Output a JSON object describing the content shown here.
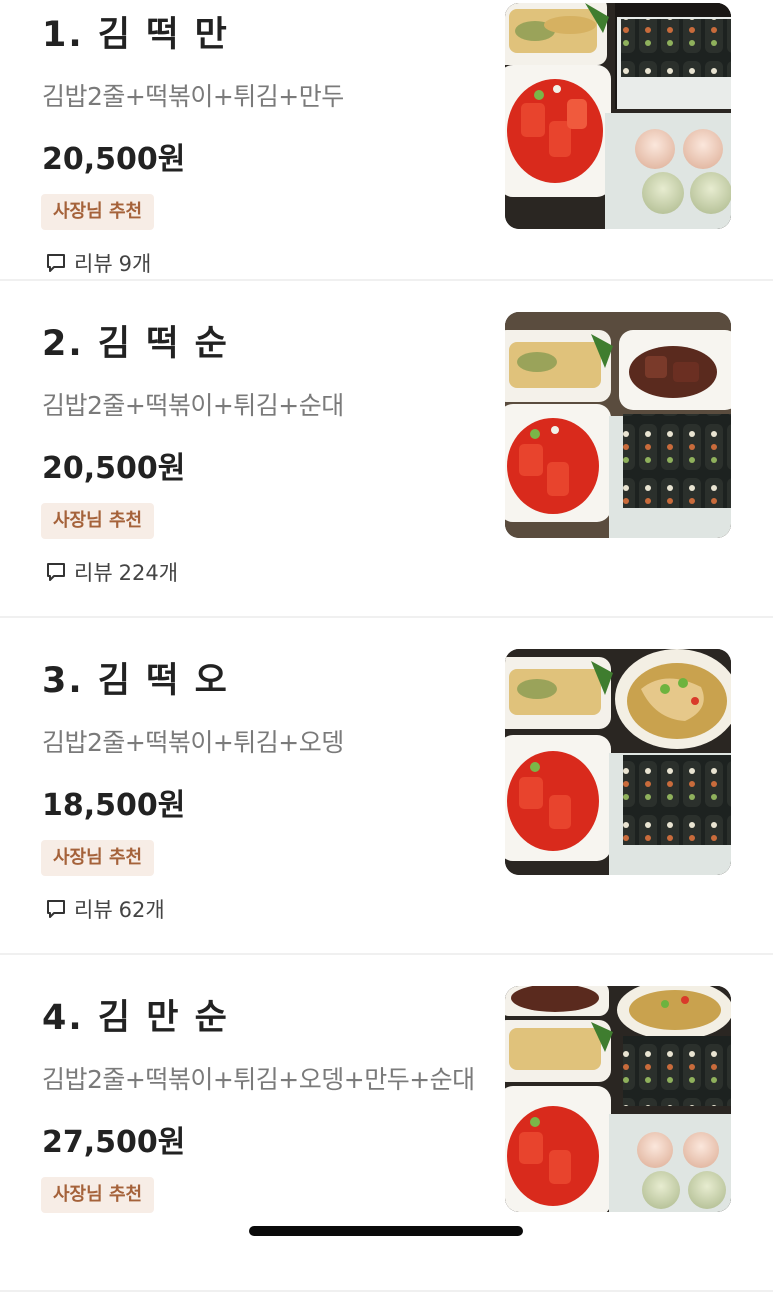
{
  "menu": {
    "items": [
      {
        "title": "1. 김 떡 만",
        "description": "김밥2줄+떡볶이+튀김+만두",
        "price": "20,500원",
        "badge": "사장님 추천",
        "review_label": "리뷰",
        "review_count": "9개",
        "photo": "kimbap-tteokbokki-twigim-mandu"
      },
      {
        "title": "2. 김 떡 순",
        "description": "김밥2줄+떡볶이+튀김+순대",
        "price": "20,500원",
        "badge": "사장님 추천",
        "review_label": "리뷰",
        "review_count": "224개",
        "photo": "kimbap-tteokbokki-twigim-sundae"
      },
      {
        "title": "3. 김 떡 오",
        "description": "김밥2줄+떡볶이+튀김+오뎅",
        "price": "18,500원",
        "badge": "사장님 추천",
        "review_label": "리뷰",
        "review_count": "62개",
        "photo": "kimbap-tteokbokki-twigim-odeng"
      },
      {
        "title": "4. 김 만 순",
        "description": "김밥2줄+떡볶이+튀김+오뎅+만두+순대",
        "price": "27,500원",
        "badge": "사장님 추천",
        "photo": "kimbap-tteokbokki-twigim-odeng-mandu-sundae"
      }
    ]
  },
  "colors": {
    "badge_bg": "#f7ede6",
    "badge_text": "#a5623a",
    "description": "#7a7a7a",
    "divider": "#f0f0f0"
  }
}
